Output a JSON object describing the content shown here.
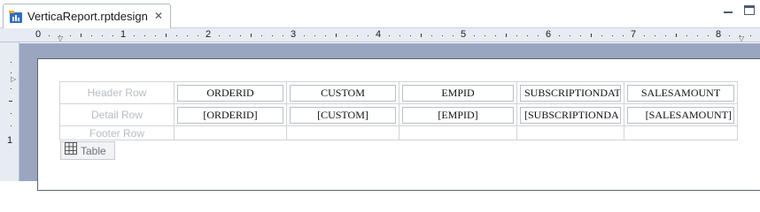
{
  "tab": {
    "title": "VerticaReport.rptdesign",
    "close_glyph": "✕",
    "icon": "report-design-icon"
  },
  "window_controls": {
    "minimize_icon": "minimize-icon",
    "maximize_icon": "maximize-icon"
  },
  "ruler": {
    "numbers": [
      "0",
      "1",
      "2",
      "3",
      "4",
      "5",
      "6",
      "7",
      "8"
    ],
    "vertical_numbers": [
      "1"
    ]
  },
  "report": {
    "rows": [
      {
        "label": "Header Row",
        "cells": [
          "ORDERID",
          "CUSTOM",
          "EMPID",
          "SUBSCRIPTIONDAT",
          "SALESAMOUNT"
        ]
      },
      {
        "label": "Detail Row",
        "cells": [
          "[ORDERID]",
          "[CUSTOM]",
          "[EMPID]",
          "[SUBSCRIPTIONDA",
          "[SALESAMOUNT]"
        ]
      },
      {
        "label": "Footer Row",
        "cells": [
          "",
          "",
          "",
          "",
          ""
        ]
      }
    ],
    "table_badge": {
      "label": "Table",
      "icon": "table-grid-icon"
    }
  },
  "colors": {
    "canvas_bg": "#9aa6c0",
    "ruler_bg": "#e7ecf3",
    "row_label": "#b7bcc4",
    "cell_border": "#b9bec6"
  }
}
